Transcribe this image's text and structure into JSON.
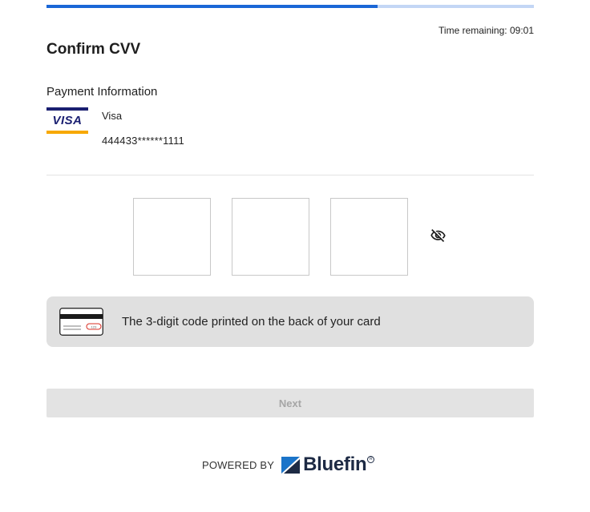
{
  "progress": {
    "fraction": 0.68,
    "fill_color": "#1a66d6",
    "track_color": "#c3d6f5"
  },
  "timer": {
    "label": "Time remaining:",
    "value": "09:01"
  },
  "page": {
    "title": "Confirm CVV"
  },
  "payment": {
    "section_title": "Payment Information",
    "card_logo_text": "VISA",
    "card_brand": "Visa",
    "card_number": "444433******1111"
  },
  "cvv": {
    "digit_1": "",
    "digit_2": "",
    "digit_3": "",
    "visibility_icon": "eye-off-icon"
  },
  "hint": {
    "text": "The 3-digit code printed on the back of your card",
    "icon": "card-back-icon",
    "cvv_marker_text": "123"
  },
  "actions": {
    "next_label": "Next"
  },
  "footer": {
    "powered_by": "POWERED BY",
    "brand_name": "Bluefin",
    "registered_mark": "R",
    "brand_color": "#1d2a44",
    "accent_color": "#1b74c9"
  }
}
